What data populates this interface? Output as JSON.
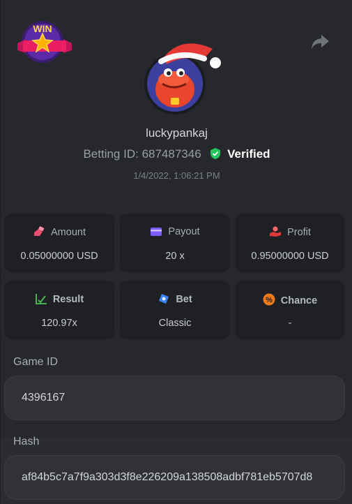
{
  "header": {
    "badge_text": "WIN",
    "username": "luckypankaj",
    "betting_id_label": "Betting ID:",
    "betting_id": "687487346",
    "verified_label": "Verified",
    "timestamp": "1/4/2022, 1:06:21 PM"
  },
  "stats": {
    "amount": {
      "label": "Amount",
      "value": "0.05000000 USD",
      "icon": "money-hand-icon",
      "color": "#e84d6b"
    },
    "payout": {
      "label": "Payout",
      "value": "20 x",
      "icon": "card-icon",
      "color": "#7b5cff"
    },
    "profit": {
      "label": "Profit",
      "value": "0.95000000 USD",
      "icon": "profit-hand-icon",
      "color": "#e03a3a"
    },
    "result": {
      "label": "Result",
      "value": "120.97x",
      "icon": "chart-check-icon",
      "color": "#4caf50"
    },
    "bet": {
      "label": "Bet",
      "value": "Classic",
      "icon": "bet-icon",
      "color": "#3b82f6"
    },
    "chance": {
      "label": "Chance",
      "value": "-",
      "icon": "percent-icon",
      "color": "#f07a1a"
    }
  },
  "game": {
    "game_id_label": "Game ID",
    "game_id": "4396167",
    "hash_label": "Hash",
    "hash": "af84b5c7a7f9a303d3f8e226209a138508adbf781eb5707d8"
  },
  "colors": {
    "verified_green": "#22c55e",
    "card_bg": "#1e2024",
    "panel_bg": "#26282c"
  }
}
